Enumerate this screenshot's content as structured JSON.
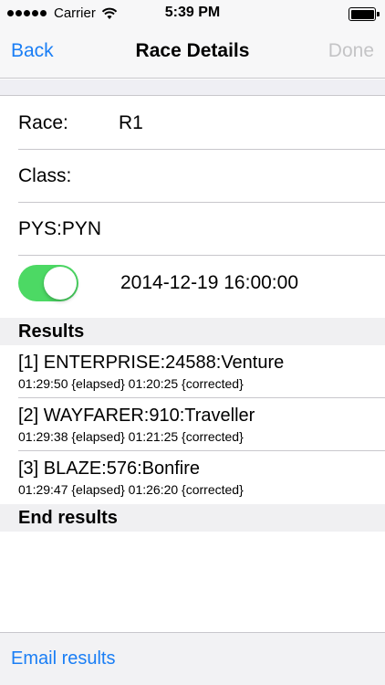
{
  "status_bar": {
    "carrier": "Carrier",
    "time": "5:39 PM",
    "battery_level": 1.0
  },
  "nav": {
    "back_label": "Back",
    "title": "Race Details",
    "done_label": "Done"
  },
  "form": {
    "race_label": "Race:",
    "race_value": "R1",
    "class_label": "Class:",
    "class_value": "",
    "pys_label": "PYS:PYN",
    "toggle_on": true,
    "datetime": "2014-12-19 16:00:00"
  },
  "results": {
    "header": "Results",
    "items": [
      {
        "title": "[1] ENTERPRISE:24588:Venture",
        "detail": "01:29:50 {elapsed} 01:20:25 {corrected}"
      },
      {
        "title": "[2] WAYFARER:910:Traveller",
        "detail": "01:29:38 {elapsed} 01:21:25 {corrected}"
      },
      {
        "title": "[3] BLAZE:576:Bonfire",
        "detail": "01:29:47 {elapsed} 01:26:20 {corrected}"
      }
    ],
    "end_header": "End results"
  },
  "toolbar": {
    "email_label": "Email results"
  },
  "colors": {
    "accent": "#1a7ef5",
    "toggle_on": "#4cd964",
    "disabled": "#c4c4c6"
  }
}
